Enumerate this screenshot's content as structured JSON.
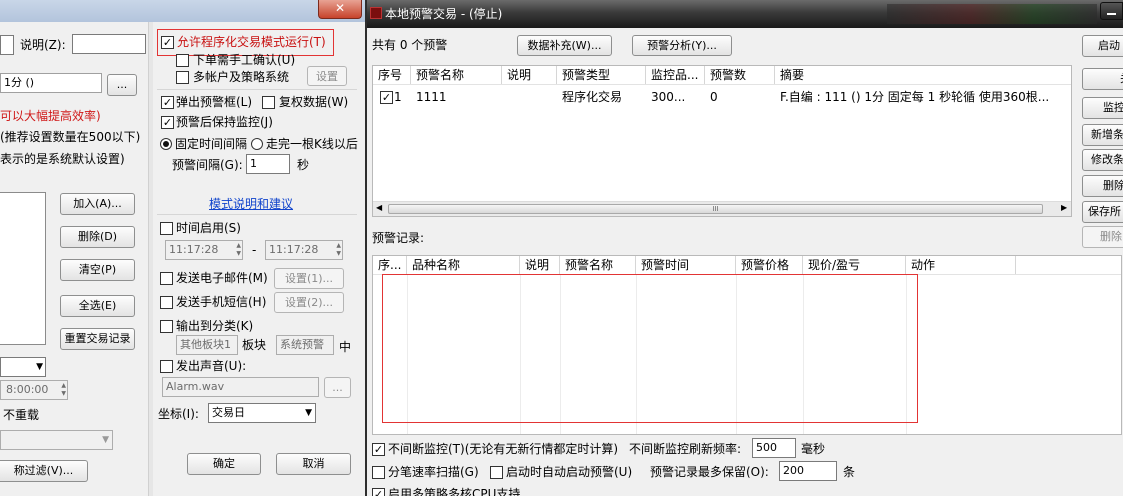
{
  "left_dialog": {
    "caption_field_label": "说明(Z):",
    "period_text": "1分 ()",
    "browse_button": "...",
    "hint_efficiency": "可以大幅提高效率)",
    "hint_count": "(推荐设置数量在500以下)",
    "hint_default": "表示的是系统默认设置)",
    "add_button": "加入(A)...",
    "delete_button": "删除(D)",
    "clear_button": "清空(P)",
    "select_all_button": "全选(E)",
    "reset_trade_button": "重置交易记录",
    "time_value": "8:00:00",
    "no_reload_label": "不重载",
    "filter_button": "称过滤(V)..."
  },
  "settings_panel": {
    "allow_program_trade": "允许程序化交易模式运行(T)",
    "manual_confirm": "下单需手工确认(U)",
    "multi_account": "多帐户及策略系统",
    "settings_button": "设置",
    "popup_alert": "弹出预警框(L)",
    "adjusted_data": "复权数据(W)",
    "keep_monitor": "预警后保持监控(J)",
    "fixed_interval": "固定时间间隔",
    "after_kline": "走完一根K线以后",
    "interval_label": "预警间隔(G):",
    "interval_value": "1",
    "interval_unit": "秒",
    "mode_link": "模式说明和建议",
    "time_enable": "时间启用(S)",
    "start_time": "11:17:28",
    "dash": "-",
    "end_time": "11:17:28",
    "send_email": "发送电子邮件(M)",
    "email_settings": "设置(1)...",
    "send_sms": "发送手机短信(H)",
    "sms_settings": "设置(2)...",
    "output_category": "输出到分类(K)",
    "other_block": "其他板块1",
    "block_label": "板块",
    "system_alert": "系统预警",
    "middle_label": "中",
    "play_sound": "发出声音(U):",
    "sound_file": "Alarm.wav",
    "sound_browse": "...",
    "coord_label": "坐标(I):",
    "coord_value": "交易日",
    "ok_button": "确定",
    "cancel_button": "取消"
  },
  "main_window": {
    "title": "本地预警交易 - (停止)",
    "summary": "共有 0 个预警",
    "data_supplement_button": "数据补充(W)...",
    "alert_analysis_button": "预警分析(Y)...",
    "columns": [
      "序号",
      "预警名称",
      "说明",
      "预警类型",
      "监控品...",
      "预警数",
      "摘要"
    ],
    "rows": [
      {
        "index": "1",
        "name": "1111",
        "desc": "",
        "type": "程序化交易",
        "target": "300...",
        "count": "0",
        "summary": "F.自编 : 111 () 1分 固定每 1 秒轮循 使用360根..."
      }
    ],
    "scroll_thumb": "III",
    "records_label": "预警记录:",
    "record_columns": [
      "序...",
      "品种名称",
      "说明",
      "预警名称",
      "预警时间",
      "预警价格",
      "现价/盈亏",
      "动作"
    ],
    "continuous_monitor": "不间断监控(T)(无论有无新行情都定时计算)",
    "refresh_label": "不间断监控刷新频率:",
    "refresh_value": "500",
    "refresh_unit": "毫秒",
    "tick_scan": "分笔速率扫描(G)",
    "auto_start": "启动时自动启动预警(U)",
    "max_records_label": "预警记录最多保留(O):",
    "max_records_value": "200",
    "max_records_unit": "条",
    "multi_core": "启用多策略多核CPU支持",
    "right_buttons": [
      "启动",
      "关",
      "监控",
      "新增条",
      "修改条",
      "删除",
      "保存所",
      "删除"
    ]
  }
}
